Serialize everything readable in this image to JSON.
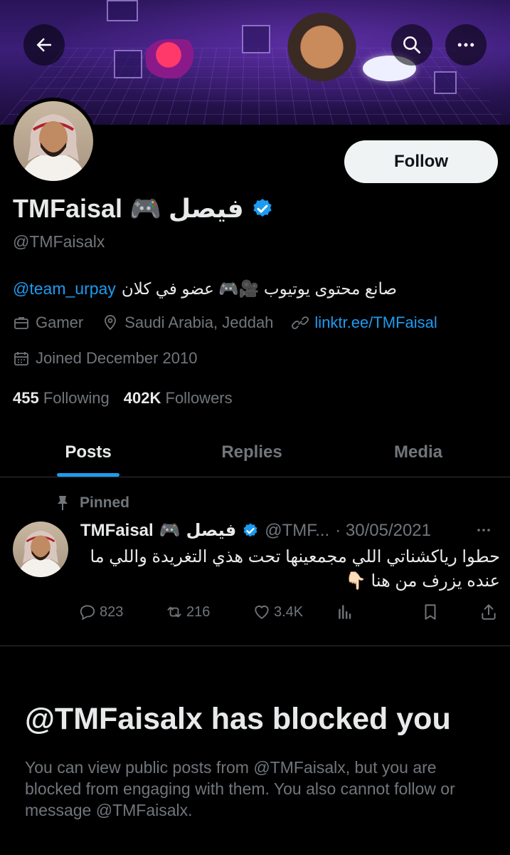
{
  "header": {
    "back_icon": "arrow-left-icon",
    "search_icon": "search-icon",
    "more_icon": "more-horizontal-icon"
  },
  "profile": {
    "display_name_latin": "TMFaisal",
    "display_name_emoji": "🎮",
    "display_name_arabic": "فيصل",
    "handle": "@TMFaisalx",
    "follow_label": "Follow",
    "bio_mention": "@team_urpay",
    "bio_text": "صانع محتوى يوتيوب 🎥🎮 عضو في كلان",
    "category": "Gamer",
    "location": "Saudi Arabia, Jeddah",
    "website": "linktr.ee/TMFaisal",
    "joined": "Joined December 2010",
    "following_count": "455",
    "following_label": "Following",
    "followers_count": "402K",
    "followers_label": "Followers",
    "verified_color": "#1d9bf0"
  },
  "tabs": [
    {
      "label": "Posts",
      "active": true
    },
    {
      "label": "Replies",
      "active": false
    },
    {
      "label": "Media",
      "active": false
    }
  ],
  "pinned_post": {
    "pinned_label": "Pinned",
    "author_latin": "TMFaisal",
    "author_emoji": "🎮",
    "author_arabic": "فيصل",
    "handle_truncated": "@TMF...",
    "date": "· 30/05/2021",
    "text": "حطوا رياكشناتي اللي مجمعينها تحت هذي التغريدة واللي ما عنده يزرف من هنا 👇🏻",
    "replies": "823",
    "reposts": "216",
    "likes": "3.4K"
  },
  "blocked": {
    "title": "@TMFaisalx has blocked you",
    "message": "You can view public posts from @TMFaisalx, but you are blocked from engaging with them. You also cannot follow or message @TMFaisalx."
  },
  "colors": {
    "background": "#000000",
    "text_primary": "#e7e9ea",
    "text_secondary": "#71767b",
    "accent": "#1d9bf0"
  }
}
